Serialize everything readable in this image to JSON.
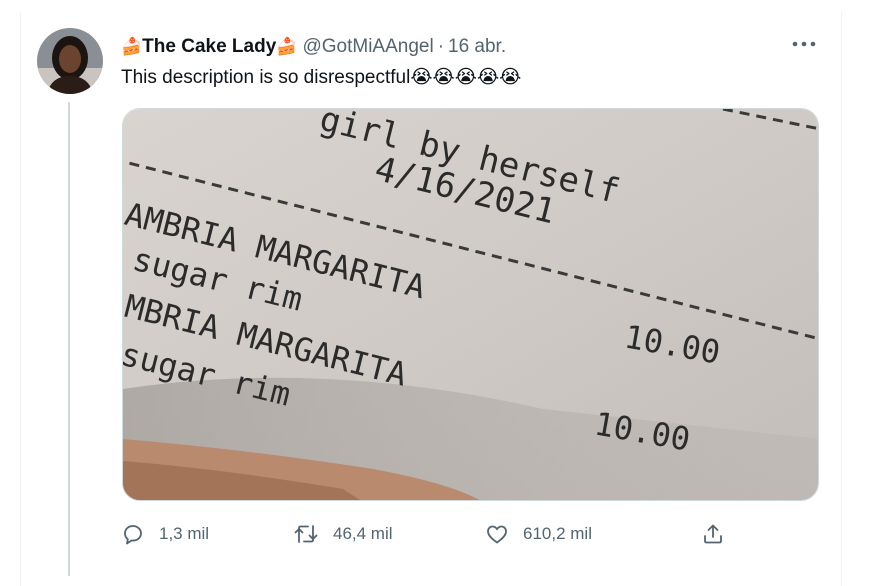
{
  "tweet": {
    "author": {
      "display_name": "The Cake Lady",
      "handle": "@GotMiAAngel",
      "name_emoji": "🍰"
    },
    "time": "16 abr.",
    "separator": "·",
    "text": "This description is so disrespectful😭😭😭😭😭",
    "image_text": {
      "line1": "girl by herself",
      "line2": "4/16/2021",
      "item1": "AMBRIA MARGARITA",
      "mod1": "sugar rim",
      "price1": "10.00",
      "item2": "MBRIA MARGARITA",
      "mod2": "sugar rim",
      "price2": "10.00"
    },
    "actions": {
      "reply_count": "1,3 mil",
      "retweet_count": "46,4 mil",
      "like_count": "610,2 mil"
    }
  },
  "colors": {
    "text_primary": "#0f1419",
    "text_secondary": "#536471",
    "thread_line": "#cfd9de",
    "icon": "#536471"
  },
  "icons": [
    "more-icon",
    "reply-icon",
    "retweet-icon",
    "like-icon",
    "share-icon"
  ]
}
